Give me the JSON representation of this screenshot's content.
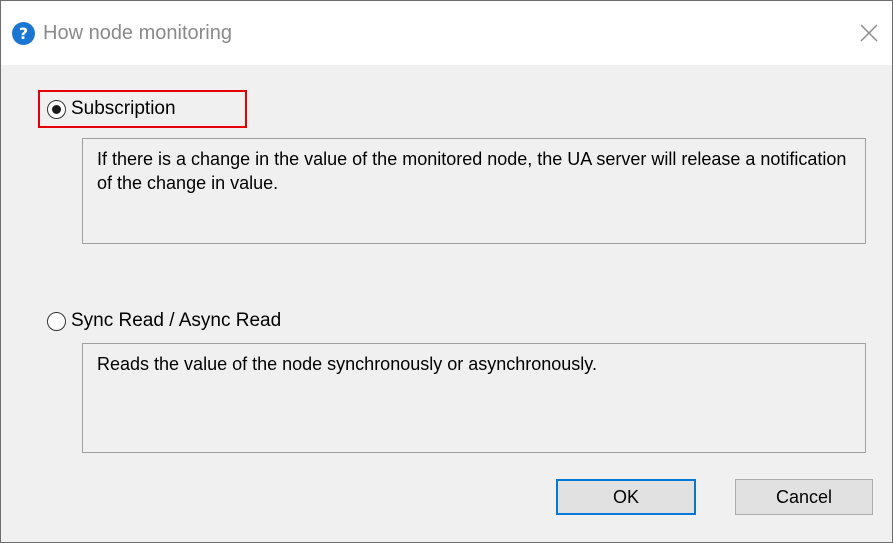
{
  "window": {
    "title": "How node monitoring",
    "icon": "question-icon",
    "close_icon": "close-icon"
  },
  "options": [
    {
      "label": "Subscription",
      "selected": true,
      "description": "If there is a change in the value of the monitored node, the UA server will release a notification of the change in value."
    },
    {
      "label": "Sync Read / Async Read",
      "selected": false,
      "description": "Reads the value of the node synchronously or asynchronously."
    }
  ],
  "buttons": {
    "ok_label": "OK",
    "cancel_label": "Cancel"
  },
  "colors": {
    "highlight": "#e60000",
    "default_button_border": "#0078d7",
    "title_icon": "#1a76d2"
  }
}
